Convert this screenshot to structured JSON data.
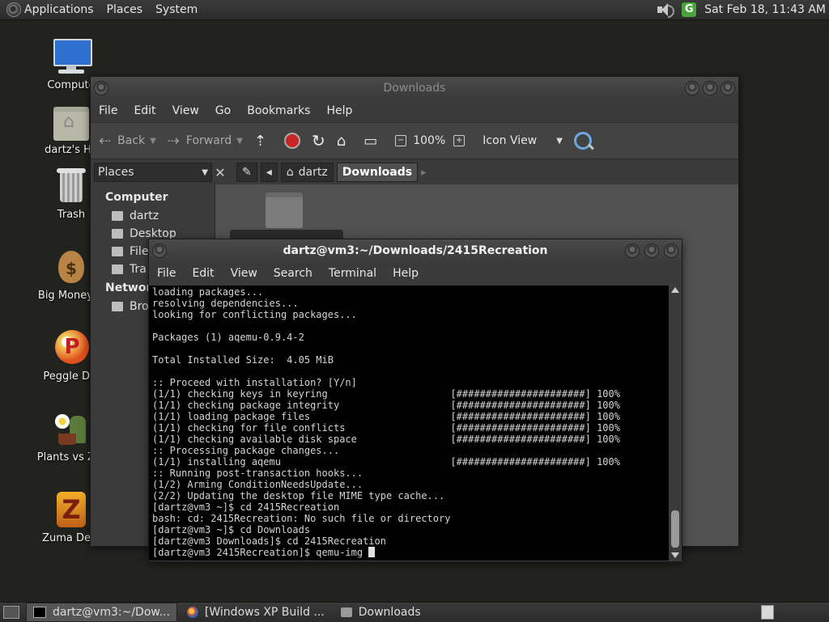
{
  "top_panel": {
    "menus": [
      "Applications",
      "Places",
      "System"
    ],
    "clock": "Sat Feb 18, 11:43 AM",
    "icons": [
      "distro-logo-icon",
      "speaker-icon",
      "update-icon"
    ]
  },
  "desktop_icons": [
    {
      "label": "Compute",
      "icon": "computer-icon"
    },
    {
      "label": "dartz's Ho",
      "icon": "home-folder-icon"
    },
    {
      "label": "Trash",
      "icon": "trash-icon"
    },
    {
      "label": "Big Money D",
      "icon": "money-bag-icon"
    },
    {
      "label": "Peggle Del",
      "icon": "peggle-icon"
    },
    {
      "label": "Plants vs Zor",
      "icon": "plants-vs-zombies-icon"
    },
    {
      "label": "Zuma Delu",
      "icon": "zuma-icon"
    }
  ],
  "file_manager": {
    "title": "Downloads",
    "menu": [
      "File",
      "Edit",
      "View",
      "Go",
      "Bookmarks",
      "Help"
    ],
    "toolbar": {
      "back": "Back",
      "forward": "Forward",
      "zoom": "100%",
      "view_mode": "Icon View"
    },
    "side_pane_selector": "Places",
    "breadcrumbs": [
      "dartz",
      "Downloads"
    ],
    "sidebar": {
      "computer_header": "Computer",
      "items": [
        "dartz",
        "Desktop",
        "File",
        "Tra"
      ],
      "network_header": "Network",
      "network_items": [
        "Bro"
      ]
    }
  },
  "terminal": {
    "title": "dartz@vm3:~/Downloads/2415Recreation",
    "menu": [
      "File",
      "Edit",
      "View",
      "Search",
      "Terminal",
      "Help"
    ],
    "lines": [
      "loading packages...",
      "resolving dependencies...",
      "looking for conflicting packages...",
      "",
      "Packages (1) aqemu-0.9.4-2",
      "",
      "Total Installed Size:  4.05 MiB",
      "",
      ":: Proceed with installation? [Y/n]",
      "(1/1) checking keys in keyring                     [######################] 100%",
      "(1/1) checking package integrity                   [######################] 100%",
      "(1/1) loading package files                        [######################] 100%",
      "(1/1) checking for file conflicts                  [######################] 100%",
      "(1/1) checking available disk space                [######################] 100%",
      ":: Processing package changes...",
      "(1/1) installing aqemu                             [######################] 100%",
      ":: Running post-transaction hooks...",
      "(1/2) Arming ConditionNeedsUpdate...",
      "(2/2) Updating the desktop file MIME type cache...",
      "[dartz@vm3 ~]$ cd 2415Recreation",
      "bash: cd: 2415Recreation: No such file or directory",
      "[dartz@vm3 ~]$ cd Downloads",
      "[dartz@vm3 Downloads]$ cd 2415Recreation"
    ],
    "prompt_line": "[dartz@vm3 2415Recreation]$ qemu-img "
  },
  "taskbar": {
    "tasks": [
      {
        "label": "dartz@vm3:~/Dow...",
        "icon": "terminal-icon",
        "active": true
      },
      {
        "label": "[Windows XP Build ...",
        "icon": "firefox-icon",
        "active": false
      },
      {
        "label": "Downloads",
        "icon": "folder-icon",
        "active": false
      }
    ]
  }
}
